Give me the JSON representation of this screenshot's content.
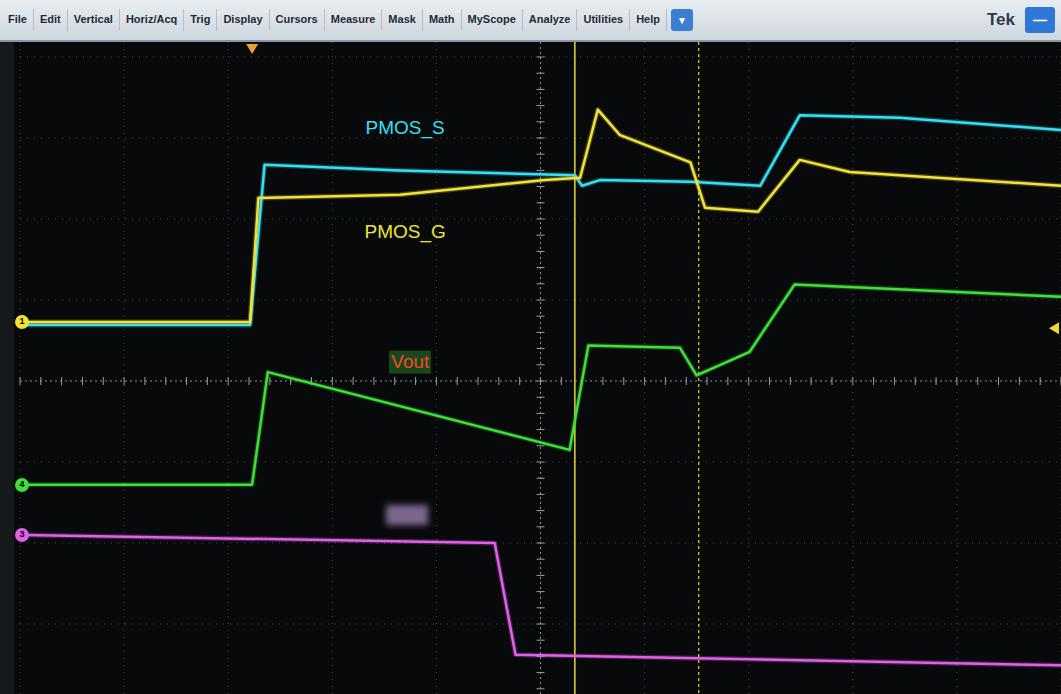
{
  "menu": {
    "items": [
      "File",
      "Edit",
      "Vertical",
      "Horiz/Acq",
      "Trig",
      "Display",
      "Cursors",
      "Measure",
      "Mask",
      "Math",
      "MyScope",
      "Analyze",
      "Utilities",
      "Help"
    ],
    "dropdown": "▼",
    "brand": "Tek",
    "minimize": "—"
  },
  "chart": {
    "series": [
      {
        "label": "PMOS_S",
        "color": "#34e0f2",
        "label_color": "#34e0f2",
        "label_at": {
          "t": 3.7,
          "v": 3.12
        },
        "t": [
          0.05,
          2.21,
          2.35,
          3.65,
          5.33,
          5.4,
          5.57,
          6.44,
          7.11,
          7.49,
          8.45,
          10.0
        ],
        "v": [
          0.69,
          0.69,
          2.67,
          2.6,
          2.54,
          2.41,
          2.48,
          2.46,
          2.41,
          3.28,
          3.25,
          3.1
        ]
      },
      {
        "label": "PMOS_G",
        "color": "#f2e23a",
        "label_color": "#f2e23a",
        "label_at": {
          "t": 3.7,
          "v": 1.84
        },
        "t": [
          0.05,
          2.21,
          2.29,
          3.65,
          5.04,
          5.38,
          5.55,
          5.76,
          6.44,
          6.58,
          7.09,
          7.49,
          7.97,
          10.0
        ],
        "v": [
          0.73,
          0.73,
          2.26,
          2.3,
          2.48,
          2.51,
          3.35,
          3.04,
          2.7,
          2.14,
          2.09,
          2.73,
          2.58,
          2.41
        ]
      },
      {
        "label": "Vout",
        "color": "#3fe03a",
        "label_color": "#ef4a2e",
        "label_at": {
          "t": 3.75,
          "v": 0.23
        },
        "t": [
          0.05,
          2.23,
          2.38,
          5.28,
          5.46,
          6.34,
          6.5,
          7.01,
          7.44,
          10.0
        ],
        "v": [
          -1.28,
          -1.28,
          0.11,
          -0.85,
          0.44,
          0.41,
          0.07,
          0.36,
          1.19,
          1.04
        ]
      },
      {
        "label": "",
        "redacted": true,
        "color": "#e060e8",
        "label_color": "#9a7fb0",
        "label_at": {
          "t": 3.72,
          "v": -1.65
        },
        "t": [
          0.05,
          4.56,
          4.76,
          10.0
        ],
        "v": [
          -1.9,
          -2.0,
          -3.38,
          -3.51
        ]
      }
    ],
    "channel_markers": [
      {
        "label": "1",
        "color": "#f2e23a",
        "v": 0.73
      },
      {
        "label": "4",
        "color": "#3fe03a",
        "v": -1.28
      },
      {
        "label": "3",
        "color": "#e060e8",
        "v": -1.9
      }
    ],
    "cursors": [
      {
        "t": 5.33,
        "kind": "solid"
      },
      {
        "t": 6.52,
        "kind": "dotted"
      }
    ],
    "trigger_position": {
      "t": 2.23
    },
    "trigger_level": {
      "v": 0.65
    }
  }
}
